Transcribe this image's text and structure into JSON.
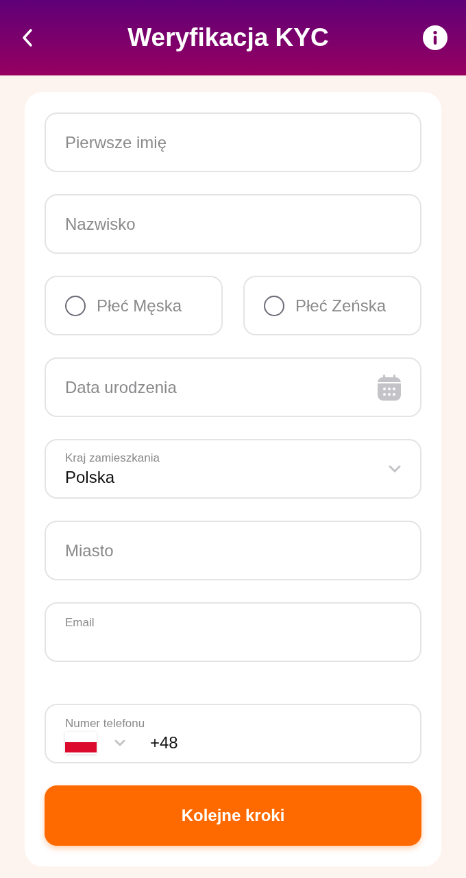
{
  "header": {
    "title": "Weryfikacja KYC"
  },
  "form": {
    "fields": [
      {
        "kind": "text",
        "placeholder": "Pierwsze imię"
      },
      {
        "kind": "text",
        "placeholder": "Nazwisko"
      },
      {
        "kind": "radio_group",
        "options": [
          {
            "label": "Płeć Męska",
            "selected": false
          },
          {
            "label": "Płeć Zeńska",
            "selected": false
          }
        ]
      },
      {
        "kind": "date",
        "placeholder": "Data urodzenia"
      },
      {
        "kind": "select",
        "label": "Kraj zamieszkania",
        "value": "Polska"
      },
      {
        "kind": "text",
        "placeholder": "Miasto"
      },
      {
        "kind": "labeled",
        "label": "Email"
      },
      {
        "kind": "phone",
        "label": "Numer telefonu",
        "code": "+48"
      }
    ],
    "submit": "Kolejne kroki"
  }
}
